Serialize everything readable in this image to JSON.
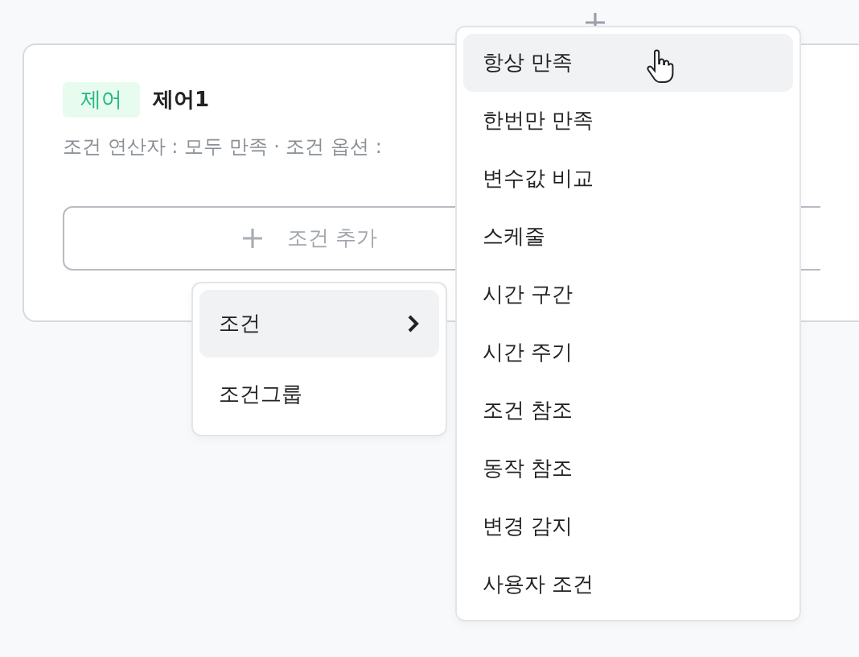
{
  "card": {
    "tag": "제어",
    "title": "제어1",
    "summary": "조건 연산자 : 모두 만족 · 조건 옵션 :",
    "buttons": [
      {
        "kind": "labeled",
        "label": "조건 추가"
      },
      {
        "kind": "icon"
      }
    ]
  },
  "menu": {
    "items": [
      {
        "label": "조건",
        "selected": true,
        "has_submenu": true
      },
      {
        "label": "조건그룹",
        "selected": false,
        "has_submenu": false
      }
    ]
  },
  "submenu": {
    "items": [
      {
        "label": "항상 만족",
        "selected": true
      },
      {
        "label": "한번만 만족",
        "selected": false
      },
      {
        "label": "변수값 비교",
        "selected": false
      },
      {
        "label": "스케줄",
        "selected": false
      },
      {
        "label": "시간 구간",
        "selected": false
      },
      {
        "label": "시간 주기",
        "selected": false
      },
      {
        "label": "조건 참조",
        "selected": false
      },
      {
        "label": "동작 참조",
        "selected": false
      },
      {
        "label": "변경 감지",
        "selected": false
      },
      {
        "label": "사용자 조건",
        "selected": false
      }
    ]
  }
}
